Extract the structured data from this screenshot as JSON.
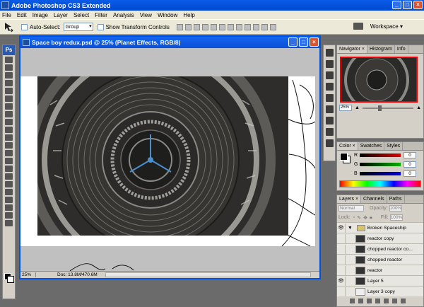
{
  "app": {
    "title": "Adobe Photoshop CS3 Extended"
  },
  "menu": [
    "File",
    "Edit",
    "Image",
    "Layer",
    "Select",
    "Filter",
    "Analysis",
    "View",
    "Window",
    "Help"
  ],
  "options": {
    "auto_select_label": "Auto-Select:",
    "auto_select_value": "Group",
    "show_transform_label": "Show Transform Controls",
    "workspace_label": "Workspace ▾"
  },
  "tools_logo": "Ps",
  "document": {
    "title": "Space boy redux.psd @ 25% (Planet Effects, RGB/8)",
    "zoom": "25%",
    "doc_info": "Doc: 13.8M/470.6M"
  },
  "navigator": {
    "tabs": [
      "Navigator ×",
      "Histogram",
      "Info"
    ],
    "zoom": "25%"
  },
  "color_panel": {
    "tabs": [
      "Color ×",
      "Swatches",
      "Styles"
    ],
    "channels": [
      {
        "label": "R",
        "value": "0",
        "color": "#e00000"
      },
      {
        "label": "G",
        "value": "0",
        "color": "#00b000"
      },
      {
        "label": "B",
        "value": "0",
        "color": "#0000e0"
      }
    ]
  },
  "layers_panel": {
    "tabs": [
      "Layers ×",
      "Channels",
      "Paths"
    ],
    "blend_mode": "Normal",
    "opacity_label": "Opacity:",
    "opacity_value": "100%",
    "lock_label": "Lock:",
    "fill_label": "Fill:",
    "fill_value": "100%",
    "layers": [
      {
        "name": "Broken Spaceship",
        "type": "group",
        "visible": true
      },
      {
        "name": "reactor copy",
        "type": "layer",
        "visible": false
      },
      {
        "name": "chopped reactor co...",
        "type": "layer",
        "visible": false
      },
      {
        "name": "chopped reactor",
        "type": "layer",
        "visible": false
      },
      {
        "name": "reactor",
        "type": "layer",
        "visible": false
      },
      {
        "name": "Layer 5",
        "type": "layer",
        "visible": true
      },
      {
        "name": "Layer 3 copy",
        "type": "layer",
        "visible": false
      }
    ]
  }
}
